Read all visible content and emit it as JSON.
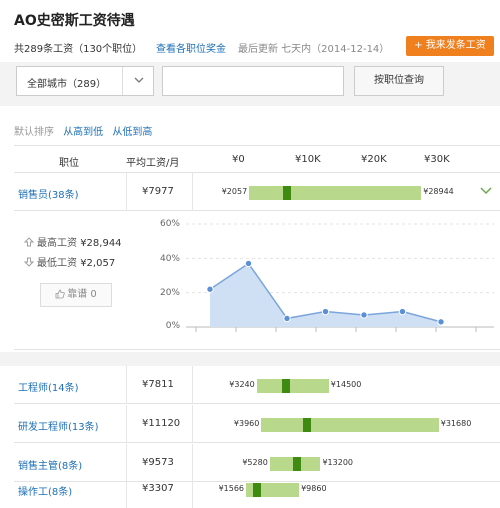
{
  "page": {
    "title": "AO史密斯工资待遇",
    "salary_count": "共289条工资（130个职位）",
    "view_bonus_link": "查看各职位奖金",
    "last_updated": "最后更新 七天内（2014-12-14）",
    "post_button": "+ 我来发条工资"
  },
  "search": {
    "city_value": "全部城市（289）",
    "job_input_value": "",
    "query_button": "按职位查询"
  },
  "sort": {
    "default_label": "默认排序",
    "high_to_low": "从高到低",
    "low_to_high": "从低到高"
  },
  "table_header": {
    "job": "职位",
    "avg": "平均工资/月",
    "ticks": [
      "¥0",
      "¥10K",
      "¥20K",
      "¥30K"
    ]
  },
  "rows": [
    {
      "job": "销售员(38条)",
      "avg": "¥7977",
      "min": "¥2057",
      "max": "¥28944",
      "min_value": 2057,
      "max_value": 28944,
      "avg_value": 7977
    },
    {
      "job": "工程师(14条)",
      "avg": "¥7811",
      "min": "¥3240",
      "max": "¥14500",
      "min_value": 3240,
      "max_value": 14500,
      "avg_value": 7811
    },
    {
      "job": "研发工程师(13条)",
      "avg": "¥11120",
      "min": "¥3960",
      "max": "¥31680",
      "min_value": 3960,
      "max_value": 31680,
      "avg_value": 11120
    },
    {
      "job": "销售主管(8条)",
      "avg": "¥9573",
      "min": "¥5280",
      "max": "¥13200",
      "min_value": 5280,
      "max_value": 13200,
      "avg_value": 9573
    },
    {
      "job": "操作工(8条)",
      "avg": "¥3307",
      "min": "¥1566",
      "max": "¥9860",
      "min_value": 1566,
      "max_value": 9860,
      "avg_value": 3307
    }
  ],
  "detail": {
    "max_label": "最高工资",
    "max_value": "¥28,944",
    "min_label": "最低工资",
    "min_value": "¥2,057",
    "like_label": "靠谱 0"
  },
  "chart_data": {
    "type": "area",
    "y_ticks": [
      "60%",
      "40%",
      "20%",
      "0%"
    ],
    "ylim": [
      0,
      60
    ],
    "values": [
      22,
      37,
      5,
      9,
      7,
      9,
      3
    ],
    "color": "#5b8fd6",
    "fill": "#cfe0f4"
  }
}
